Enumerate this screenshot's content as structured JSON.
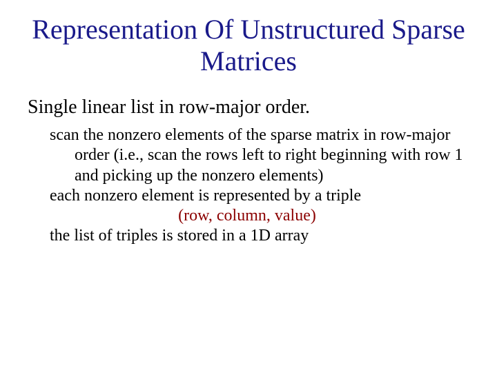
{
  "slide": {
    "title": "Representation Of Unstructured Sparse Matrices",
    "heading": "Single linear list in row-major order.",
    "body": {
      "p1": "scan the nonzero elements of the sparse matrix in row-major order (i.e., scan the rows left to right beginning with row 1 and picking up the nonzero elements)",
      "p2": "each nonzero element is represented by a triple",
      "triple": "(row, column, value)",
      "p3": "the list of triples is stored in a 1D array"
    }
  }
}
